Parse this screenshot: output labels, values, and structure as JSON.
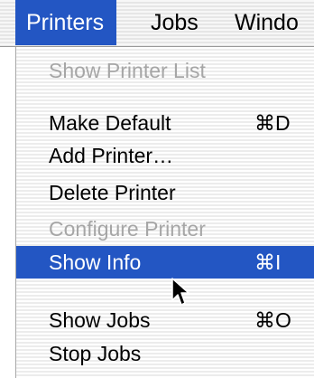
{
  "menubar": {
    "items": [
      {
        "label": "Printers"
      },
      {
        "label": "Jobs"
      },
      {
        "label": "Windo"
      }
    ]
  },
  "menu": {
    "items": [
      {
        "label": "Show Printer List",
        "shortcut": ""
      },
      {
        "label": "Make Default",
        "shortcut": "⌘D"
      },
      {
        "label": "Add Printer…",
        "shortcut": ""
      },
      {
        "label": "Delete Printer",
        "shortcut": ""
      },
      {
        "label": "Configure Printer",
        "shortcut": ""
      },
      {
        "label": "Show Info",
        "shortcut": "⌘I"
      },
      {
        "label": "Show Jobs",
        "shortcut": "⌘O"
      },
      {
        "label": "Stop Jobs",
        "shortcut": ""
      }
    ]
  },
  "colors": {
    "highlight": "#2356c3",
    "disabled_text": "#a6a6a6"
  },
  "icons": {
    "pointer": "arrow-cursor-icon",
    "command_key": "command-key-glyph"
  }
}
